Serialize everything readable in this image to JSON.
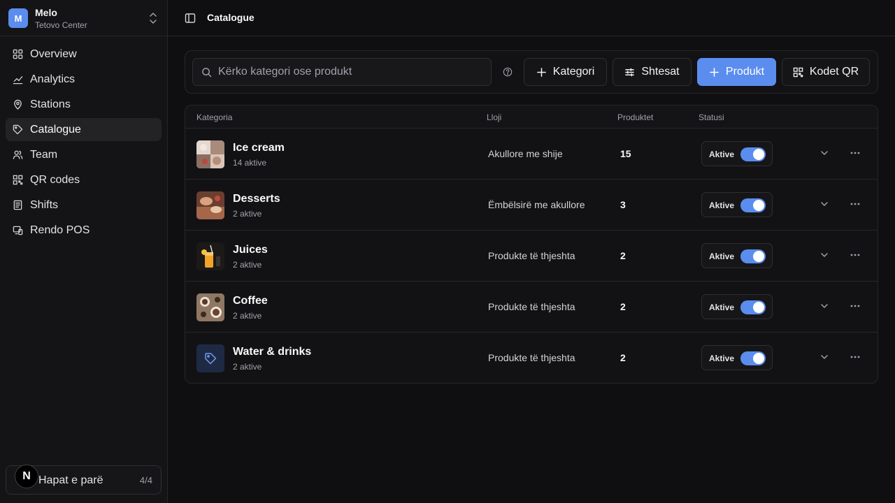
{
  "org": {
    "initial": "M",
    "name": "Melo",
    "location": "Tetovo Center"
  },
  "nav": {
    "items": [
      {
        "label": "Overview",
        "icon": "grid-icon"
      },
      {
        "label": "Analytics",
        "icon": "chart-icon"
      },
      {
        "label": "Stations",
        "icon": "map-pin-icon"
      },
      {
        "label": "Catalogue",
        "icon": "tag-icon",
        "active": true
      },
      {
        "label": "Team",
        "icon": "users-icon"
      },
      {
        "label": "QR codes",
        "icon": "qr-icon"
      },
      {
        "label": "Shifts",
        "icon": "document-icon"
      },
      {
        "label": "Rendo POS",
        "icon": "devices-icon"
      }
    ]
  },
  "steps": {
    "badge": "N",
    "label": "Hapat e parë",
    "count": "4/4"
  },
  "header": {
    "title": "Catalogue"
  },
  "toolbar": {
    "search_placeholder": "Kërko kategori ose produkt",
    "category_button": "Kategori",
    "addons_button": "Shtesat",
    "product_button": "Produkt",
    "qr_button": "Kodet QR"
  },
  "table": {
    "columns": [
      "Kategoria",
      "Lloji",
      "Produktet",
      "Statusi"
    ],
    "rows": [
      {
        "name": "Ice cream",
        "sub": "14 aktive",
        "type": "Akullore me shije",
        "count": "15",
        "status": "Aktive",
        "active": true
      },
      {
        "name": "Desserts",
        "sub": "2 aktive",
        "type": "Ëmbëlsirë me akullore",
        "count": "3",
        "status": "Aktive",
        "active": true
      },
      {
        "name": "Juices",
        "sub": "2 aktive",
        "type": "Produkte të thjeshta",
        "count": "2",
        "status": "Aktive",
        "active": true
      },
      {
        "name": "Coffee",
        "sub": "2 aktive",
        "type": "Produkte të thjeshta",
        "count": "2",
        "status": "Aktive",
        "active": true
      },
      {
        "name": "Water & drinks",
        "sub": "2 aktive",
        "type": "Produkte të thjeshta",
        "count": "2",
        "status": "Aktive",
        "active": true
      }
    ]
  },
  "colors": {
    "accent": "#5b8def",
    "background": "#0f0f11",
    "border": "#27272a"
  }
}
